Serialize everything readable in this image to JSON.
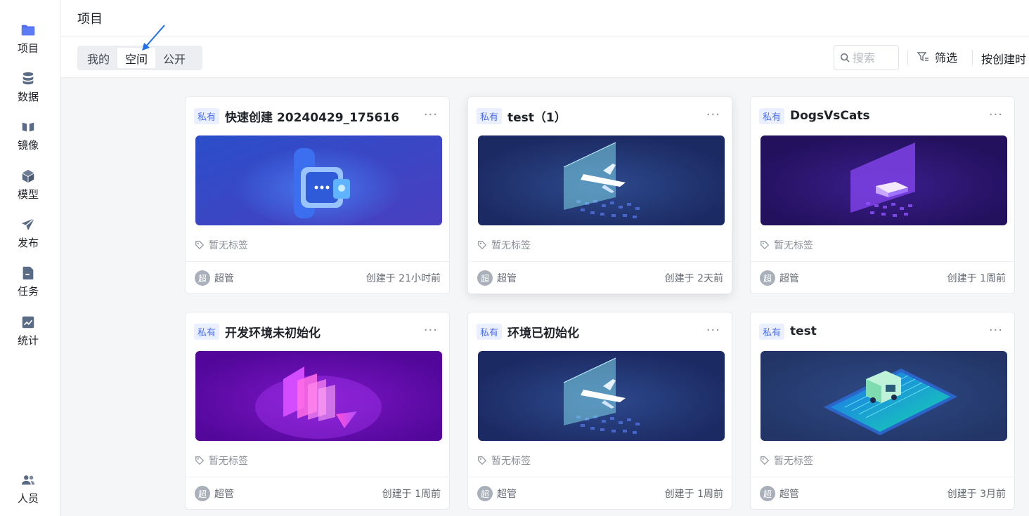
{
  "sidebar": {
    "items": [
      {
        "label": "项目",
        "icon": "folder-icon"
      },
      {
        "label": "数据",
        "icon": "database-icon"
      },
      {
        "label": "镜像",
        "icon": "image-mirror-icon"
      },
      {
        "label": "模型",
        "icon": "cube-icon"
      },
      {
        "label": "发布",
        "icon": "paper-plane-icon"
      },
      {
        "label": "任务",
        "icon": "task-icon"
      },
      {
        "label": "统计",
        "icon": "chart-icon"
      }
    ],
    "bottom": {
      "label": "人员",
      "icon": "users-icon"
    }
  },
  "header": {
    "title": "项目"
  },
  "toolbar": {
    "tabs": [
      {
        "label": "我的"
      },
      {
        "label": "空间"
      },
      {
        "label": "公开"
      }
    ],
    "active_tab": "空间",
    "search_placeholder": "搜索",
    "filter_label": "筛选",
    "sort_label": "按创建时"
  },
  "colors": {
    "accent": "#4e6ef2",
    "sidebar_icon": "#5a6b85"
  },
  "cards": [
    {
      "badge": "私有",
      "title": "快速创建 20240429_175616",
      "tags": "暂无标签",
      "avatar": "超",
      "owner": "超管",
      "created": "创建于 21小时前"
    },
    {
      "badge": "私有",
      "title": "test（1）",
      "tags": "暂无标签",
      "avatar": "超",
      "owner": "超管",
      "created": "创建于 2天前"
    },
    {
      "badge": "私有",
      "title": "DogsVsCats",
      "tags": "暂无标签",
      "avatar": "超",
      "owner": "超管",
      "created": "创建于 1周前"
    },
    {
      "badge": "私有",
      "title": "开发环境未初始化",
      "tags": "暂无标签",
      "avatar": "超",
      "owner": "超管",
      "created": "创建于 1周前"
    },
    {
      "badge": "私有",
      "title": "环境已初始化",
      "tags": "暂无标签",
      "avatar": "超",
      "owner": "超管",
      "created": "创建于 1周前"
    },
    {
      "badge": "私有",
      "title": "test",
      "tags": "暂无标签",
      "avatar": "超",
      "owner": "超管",
      "created": "创建于 3月前"
    }
  ]
}
